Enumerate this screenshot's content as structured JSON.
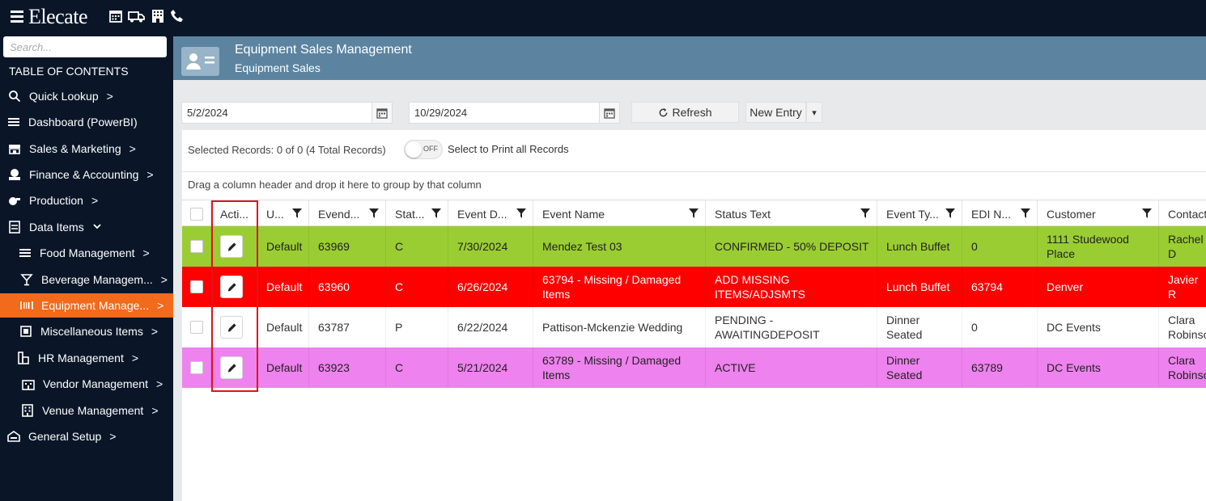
{
  "app": {
    "logo_text": "Elecate"
  },
  "top_icons": [
    "calendar-icon",
    "truck-icon",
    "building-icon",
    "phone-icon"
  ],
  "sidebar": {
    "search_placeholder": "Search...",
    "toc_title": "TABLE OF CONTENTS",
    "items": [
      {
        "label": "Quick Lookup",
        "icon": "search-icon",
        "chevron": ">"
      },
      {
        "label": "Dashboard (PowerBI)",
        "icon": "menu-icon",
        "chevron": ""
      },
      {
        "label": "Sales & Marketing",
        "icon": "store-icon",
        "chevron": ">"
      },
      {
        "label": "Finance & Accounting",
        "icon": "money-icon",
        "chevron": ">"
      },
      {
        "label": "Production",
        "icon": "production-icon",
        "chevron": ">"
      },
      {
        "label": "Data Items",
        "icon": "data-icon",
        "chevron": "v"
      },
      {
        "label": "Food Management",
        "icon": "list-icon",
        "chevron": ">"
      },
      {
        "label": "Beverage Managem...",
        "icon": "cocktail-icon",
        "chevron": ">"
      },
      {
        "label": "Equipment Manage...",
        "icon": "barcode-icon",
        "chevron": ">",
        "active": true
      },
      {
        "label": "Miscellaneous Items",
        "icon": "misc-icon",
        "chevron": ">"
      },
      {
        "label": "HR Management",
        "icon": "hr-icon",
        "chevron": ">"
      },
      {
        "label": "Vendor Management",
        "icon": "vendor-icon",
        "chevron": ">"
      },
      {
        "label": "Venue Management",
        "icon": "venue-icon",
        "chevron": ">"
      },
      {
        "label": "General Setup",
        "icon": "setup-icon",
        "chevron": ">"
      }
    ]
  },
  "header": {
    "title": "Equipment Sales Management",
    "subtitle": "Equipment Sales"
  },
  "toolbar": {
    "start_date": "5/2/2024",
    "end_date": "10/29/2024",
    "refresh_label": "Refresh",
    "new_entry_label": "New Entry",
    "dropdown_glyph": "▾"
  },
  "records": {
    "selected_text": "Selected Records: 0 of 0 (4 Total Records)",
    "toggle_label": "OFF",
    "print_all_label": "Select to Print all Records",
    "group_hint": "Drag a column header and drop it here to group by that column"
  },
  "columns": [
    "Acti...",
    "U...",
    "Evend...",
    "Stat...",
    "Event D...",
    "Event Name",
    "Status Text",
    "Event Ty...",
    "EDI N...",
    "Customer",
    "Contact"
  ],
  "rows": [
    {
      "check": "",
      "user": "Default",
      "evend": "63969",
      "stat": "C",
      "date": "7/30/2024",
      "name": "Mendez Test 03",
      "status": "CONFIRMED - 50% DEPOSIT",
      "type": "Lunch Buffet",
      "edi": "0",
      "customer": "1111 Studewood Place",
      "contact": "Rachel D",
      "bg": "#9acd32",
      "fg": "#222222"
    },
    {
      "check": "",
      "user": "Default",
      "evend": "63960",
      "stat": "C",
      "date": "6/26/2024",
      "name": "63794 - Missing / Damaged Items",
      "status": "ADD MISSING ITEMS/ADJSMTS",
      "type": "Lunch Buffet",
      "edi": "63794",
      "customer": "Denver",
      "contact": "Javier R",
      "bg": "#ff0000",
      "fg": "#ffffff"
    },
    {
      "check": "",
      "user": "Default",
      "evend": "63787",
      "stat": "P",
      "date": "6/22/2024",
      "name": "Pattison-Mckenzie Wedding",
      "status": "PENDING - AWAITINGDEPOSIT",
      "type": "Dinner Seated",
      "edi": "0",
      "customer": "DC Events",
      "contact": "Clara Robinso",
      "bg": "#ffffff",
      "fg": "#333333"
    },
    {
      "check": "",
      "user": "Default",
      "evend": "63923",
      "stat": "C",
      "date": "5/21/2024",
      "name": "63789 - Missing / Damaged Items",
      "status": "ACTIVE",
      "type": "Dinner Seated",
      "edi": "63789",
      "customer": "DC Events",
      "contact": "Clara Robinso",
      "bg": "#ee82ee",
      "fg": "#222222"
    }
  ]
}
